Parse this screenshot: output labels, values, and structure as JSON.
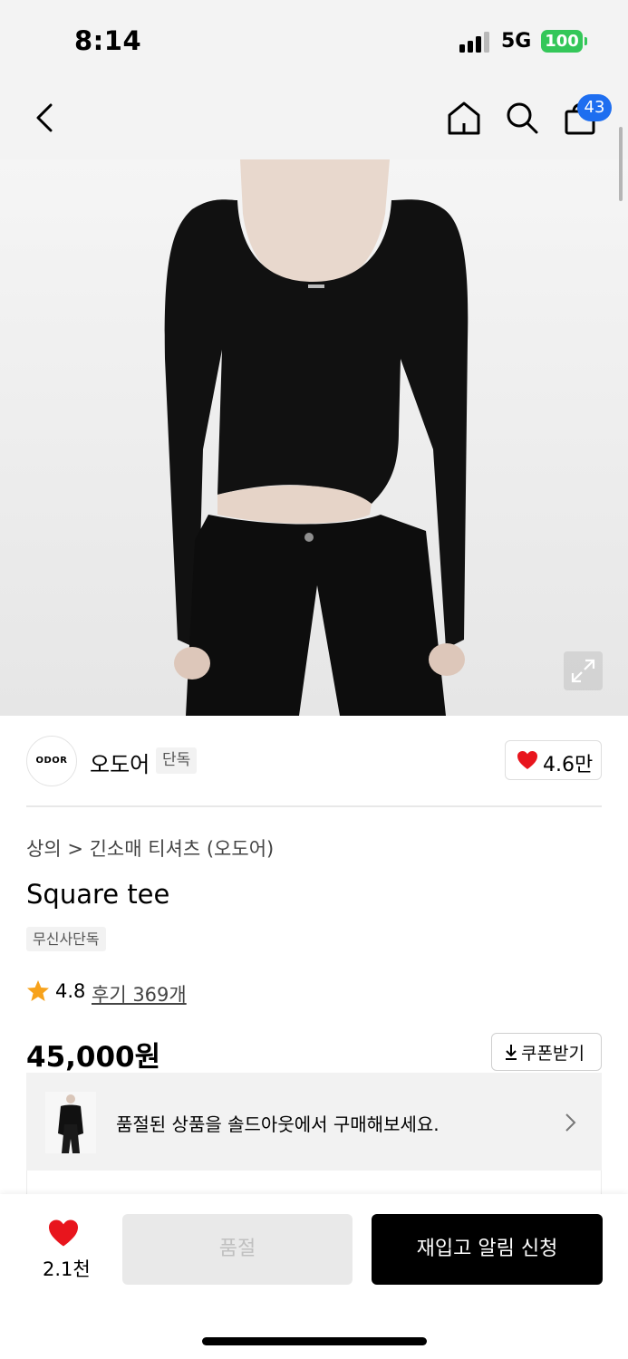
{
  "status_bar": {
    "time": "8:14",
    "network": "5G",
    "battery": "100"
  },
  "nav": {
    "cart_count": "43"
  },
  "product_image": {
    "icon": "expand-icon"
  },
  "brand": {
    "logo_text": "ODOR",
    "name": "오도어",
    "tag": "단독",
    "likes": "4.6만"
  },
  "product": {
    "breadcrumb": "상의 > 긴소매 티셔츠 (오도어)",
    "title": "Square tee",
    "tag": "무신사단독",
    "rating": "4.8",
    "reviews": "후기 369개",
    "price": "45,000원",
    "coupon_label": "쿠폰받기"
  },
  "soldout_banner": {
    "text": "품절된 상품을 솔드아웃에서 구매해보세요."
  },
  "bottom_bar": {
    "wish_count": "2.1천",
    "soldout_label": "품절",
    "restock_label": "재입고 알림 신청"
  },
  "colors": {
    "accent_blue": "#1e6ef0",
    "heart_red": "#e8151d",
    "star_orange": "#f7a21b",
    "battery_green": "#34c759"
  }
}
